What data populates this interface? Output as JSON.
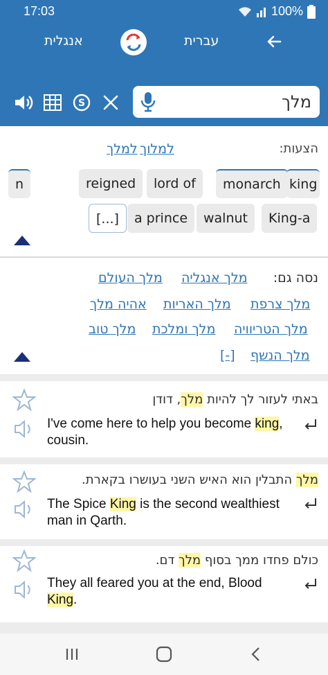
{
  "status_bar": {
    "time": "17:03",
    "battery": "100%"
  },
  "header": {
    "source_language": "אנגלית",
    "target_language": "עברית"
  },
  "search": {
    "value": "מלך"
  },
  "suggestions": {
    "title": "הצעות:",
    "links": [
      "למלך",
      "למלוך"
    ],
    "chips": [
      "n",
      "reigned",
      "lord of",
      "monarch",
      "king",
      "[...]",
      "a prince",
      "walnut",
      "King-a"
    ]
  },
  "see_also": {
    "label": "נסה גם:",
    "links": [
      "מלך אנגליה",
      "מלך העולם",
      "מלך צרפת",
      "מלך האריות",
      "אהיה מלך",
      "מלך הטריוויה",
      "מלך ומלכת",
      "מלך טוב",
      "מלך הנשף",
      "[-]"
    ]
  },
  "examples": [
    {
      "he_before": "באתי לעזור לך להיות ",
      "he_highlight": "מלך",
      "he_after": ", דודן",
      "en_before": "I've come here to help you become ",
      "en_highlight": "king",
      "en_after": ", cousin."
    },
    {
      "he_before": "",
      "he_highlight": "מלך",
      "he_after": " התבלין הוא האיש השני בעושרו בקארת.",
      "en_before": "The Spice ",
      "en_highlight": "King",
      "en_after": " is the second wealthiest man in Qarth."
    },
    {
      "he_before": "כולם פחדו ממך בסוף ",
      "he_highlight": "מלך",
      "he_after": " דם.",
      "en_before": "They all feared you at the end, Blood ",
      "en_highlight": "King",
      "en_after": "."
    }
  ]
}
